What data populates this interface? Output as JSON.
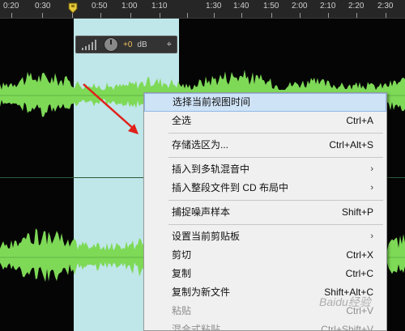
{
  "ruler": {
    "ticks": [
      "0:20",
      "0:30",
      "0:50",
      "1:00",
      "1:10",
      "1:30",
      "1:40",
      "1:50",
      "2:00",
      "2:10",
      "2:20",
      "2:30"
    ]
  },
  "hud": {
    "volume_value": "+0",
    "volume_unit": "dB",
    "pin_icon": "pin-icon"
  },
  "context_menu": {
    "items": [
      {
        "label": "选择当前视图时间",
        "shortcut": "",
        "highlight": true
      },
      {
        "label": "全选",
        "shortcut": "Ctrl+A"
      },
      {
        "separator": true
      },
      {
        "label": "存储选区为...",
        "shortcut": "Ctrl+Alt+S"
      },
      {
        "separator": true
      },
      {
        "label": "插入到多轨混音中",
        "shortcut": "",
        "submenu": true
      },
      {
        "label": "插入整段文件到 CD 布局中",
        "shortcut": "",
        "submenu": true
      },
      {
        "separator": true
      },
      {
        "label": "捕捉噪声样本",
        "shortcut": "Shift+P"
      },
      {
        "separator": true
      },
      {
        "label": "设置当前剪贴板",
        "shortcut": "",
        "submenu": true
      },
      {
        "label": "剪切",
        "shortcut": "Ctrl+X"
      },
      {
        "label": "复制",
        "shortcut": "Ctrl+C"
      },
      {
        "label": "复制为新文件",
        "shortcut": "Shift+Alt+C"
      },
      {
        "label": "粘贴",
        "shortcut": "Ctrl+V",
        "disabled": true
      },
      {
        "label": "混合式粘贴...",
        "shortcut": "Ctrl+Shift+V",
        "disabled": true
      }
    ]
  },
  "watermark": "Baidu经验",
  "colors": {
    "waveform": "#7ed957",
    "selection": "#c9f2f4",
    "menu_highlight": "#cfe3f7",
    "arrow": "#e0201a"
  }
}
